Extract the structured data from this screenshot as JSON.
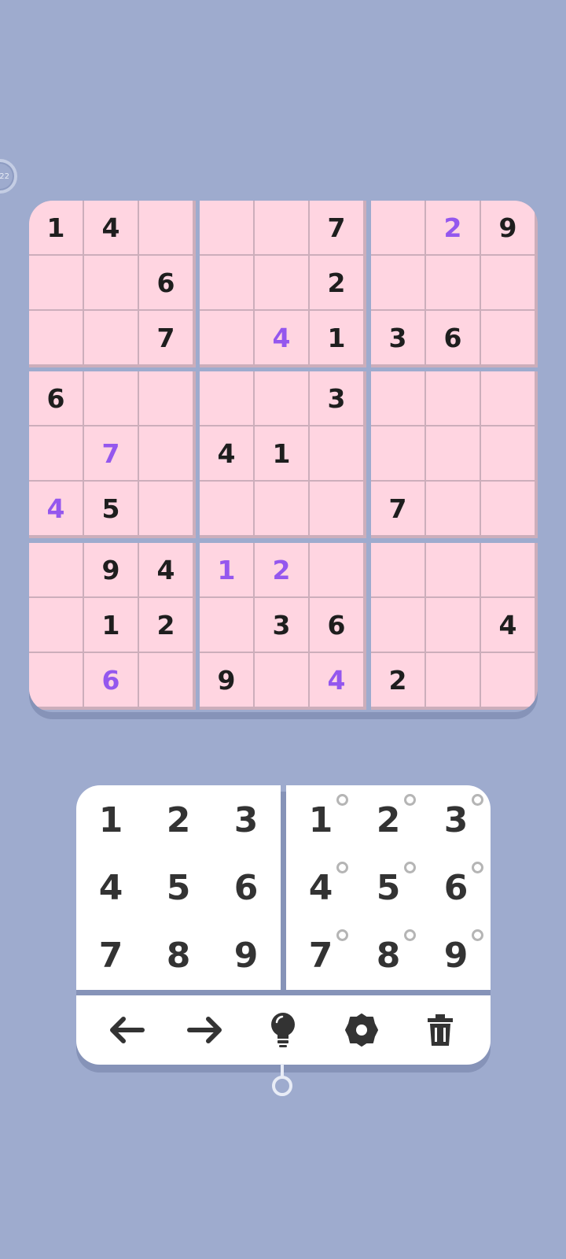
{
  "timer": {
    "text": "22"
  },
  "board": {
    "cells": [
      [
        "1",
        "4",
        "",
        "",
        "",
        "7",
        "",
        "2",
        "9"
      ],
      [
        "",
        "",
        "6",
        "",
        "",
        "2",
        "",
        "",
        ""
      ],
      [
        "",
        "",
        "7",
        "",
        "4",
        "1",
        "3",
        "6",
        ""
      ],
      [
        "6",
        "",
        "",
        "",
        "",
        "3",
        "",
        "",
        ""
      ],
      [
        "",
        "7",
        "",
        "4",
        "1",
        "",
        "",
        "",
        ""
      ],
      [
        "4",
        "5",
        "",
        "",
        "",
        "",
        "7",
        "",
        ""
      ],
      [
        "",
        "9",
        "4",
        "1",
        "2",
        "",
        "",
        "",
        ""
      ],
      [
        "",
        "1",
        "2",
        "",
        "3",
        "6",
        "",
        "",
        "4"
      ],
      [
        "",
        "6",
        "",
        "9",
        "",
        "4",
        "2",
        "",
        ""
      ]
    ],
    "user_entered": [
      [
        0,
        0,
        0,
        0,
        0,
        0,
        0,
        1,
        0
      ],
      [
        0,
        0,
        0,
        0,
        0,
        0,
        0,
        0,
        0
      ],
      [
        0,
        0,
        0,
        0,
        1,
        0,
        0,
        0,
        0
      ],
      [
        0,
        0,
        0,
        0,
        0,
        0,
        0,
        0,
        0
      ],
      [
        0,
        1,
        0,
        0,
        0,
        0,
        0,
        0,
        0
      ],
      [
        1,
        0,
        0,
        0,
        0,
        0,
        0,
        0,
        0
      ],
      [
        0,
        0,
        0,
        1,
        1,
        0,
        0,
        0,
        0
      ],
      [
        0,
        0,
        0,
        0,
        0,
        0,
        0,
        0,
        0
      ],
      [
        0,
        1,
        0,
        0,
        0,
        1,
        0,
        0,
        0
      ]
    ],
    "colors": {
      "given": "#1e1e1e",
      "user": "#9457ee",
      "cell_bg": "#ffd5e1"
    }
  },
  "keypad": {
    "numbers": [
      "1",
      "2",
      "3",
      "4",
      "5",
      "6",
      "7",
      "8",
      "9"
    ],
    "notes": [
      "1",
      "2",
      "3",
      "4",
      "5",
      "6",
      "7",
      "8",
      "9"
    ]
  },
  "tools": [
    {
      "icon": "arrow-left-icon"
    },
    {
      "icon": "arrow-right-icon"
    },
    {
      "icon": "lightbulb-icon"
    },
    {
      "icon": "settings-gear-icon"
    },
    {
      "icon": "trash-icon"
    }
  ],
  "colors": {
    "background": "#9eabce",
    "keypad_bg": "#ffffff",
    "key_text": "#333333"
  }
}
